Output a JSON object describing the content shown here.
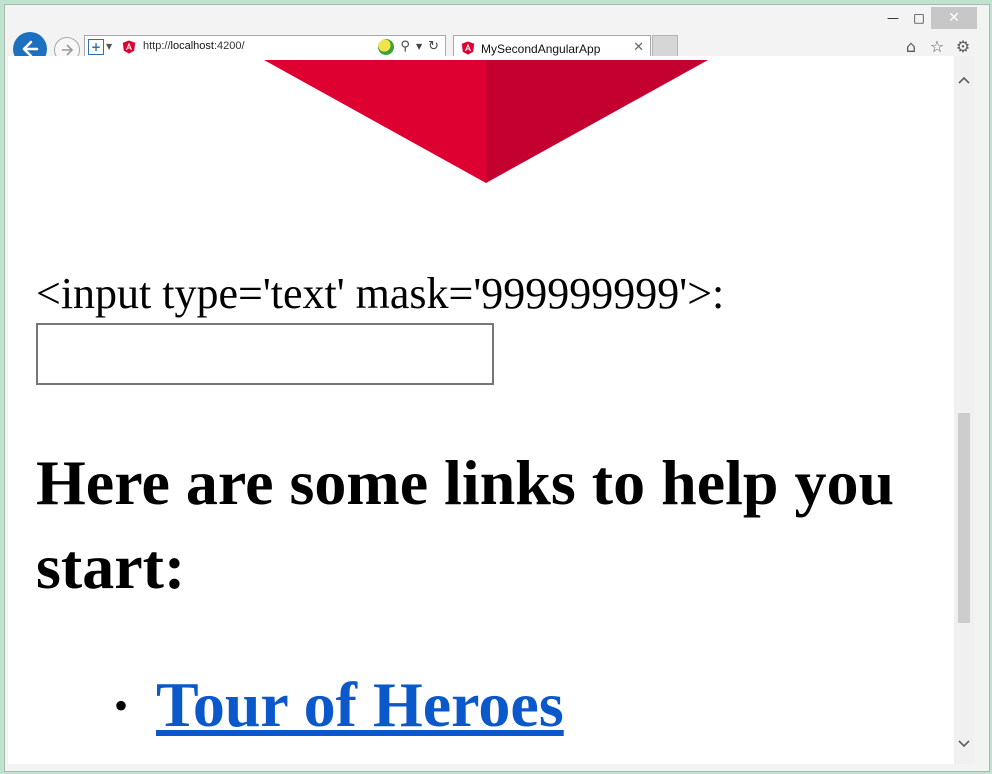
{
  "window": {
    "minimize_glyph": "—",
    "maximize_glyph": "□",
    "close_glyph": "✕"
  },
  "toolbar": {
    "address": {
      "url_scheme": "http://",
      "url_host": "localhost",
      "url_rest": ":4200/"
    },
    "tab": {
      "title": "MySecondAngularApp",
      "close_glyph": "✕"
    },
    "icons": [
      "back-icon",
      "forward-icon",
      "compat-view-icon",
      "angular-favicon",
      "search-icon",
      "dropdown-icon",
      "refresh-icon",
      "home-icon",
      "favorites-star-icon",
      "settings-gear-icon"
    ]
  },
  "page": {
    "mask_label": "<input type='text' mask='999999999'>:",
    "mask_input": {
      "value": "",
      "placeholder": ""
    },
    "heading": "Here are some links to help you start:",
    "bullet": "•",
    "links": [
      {
        "label": "Tour of Heroes"
      }
    ]
  },
  "colors": {
    "angular_red": "#dd0031",
    "angular_dark_red": "#c3002f",
    "link_blue": "#0a58ca",
    "back_blue": "#1d6fc0"
  }
}
